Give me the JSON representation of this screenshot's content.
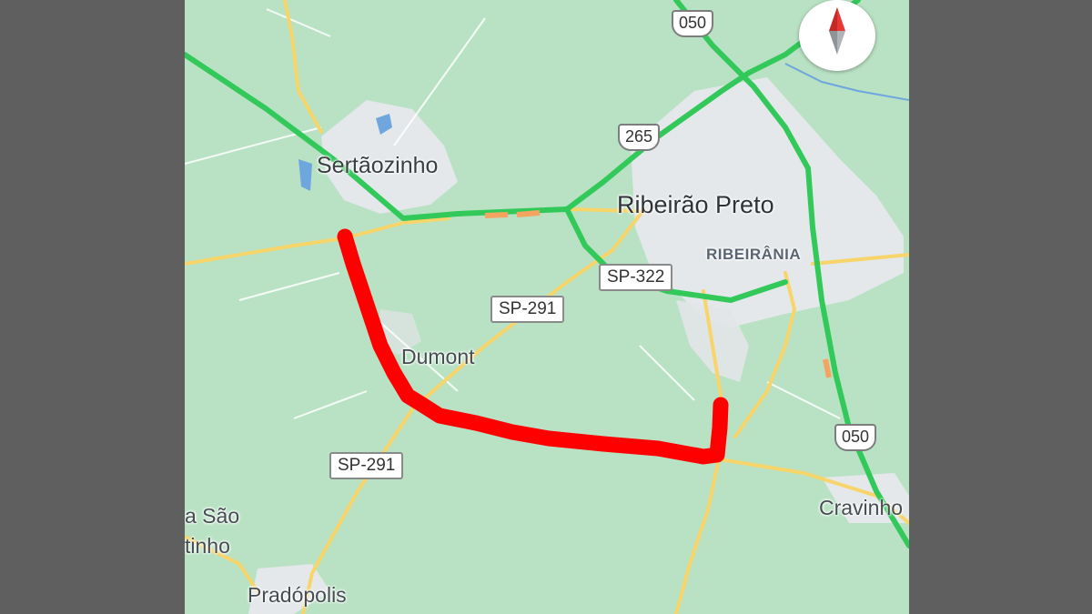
{
  "map": {
    "places": {
      "sertaozinho": "Sertãozinho",
      "ribeirao_preto": "Ribeirão Preto",
      "ribeirania": "RIBEIRÂNIA",
      "dumont": "Dumont",
      "cravinhos": "Cravinho",
      "sao_martinho_line1": "a São",
      "sao_martinho_line2": "tinho",
      "pradopolis": "Pradópolis"
    },
    "roads": {
      "sp322": "SP-322",
      "sp291_upper": "SP-291",
      "sp291_lower": "SP-291",
      "r265": "265",
      "r050_top": "050",
      "r050_right": "050"
    },
    "compass": {
      "icon": "compass-needle-icon"
    },
    "colors": {
      "land": "#b9e2c4",
      "urban": "#e6e9ea",
      "highway_green": "#32c95a",
      "road_yellow": "#f7d56b",
      "route_red": "#ff0000",
      "water": "#6fa6dd"
    }
  }
}
